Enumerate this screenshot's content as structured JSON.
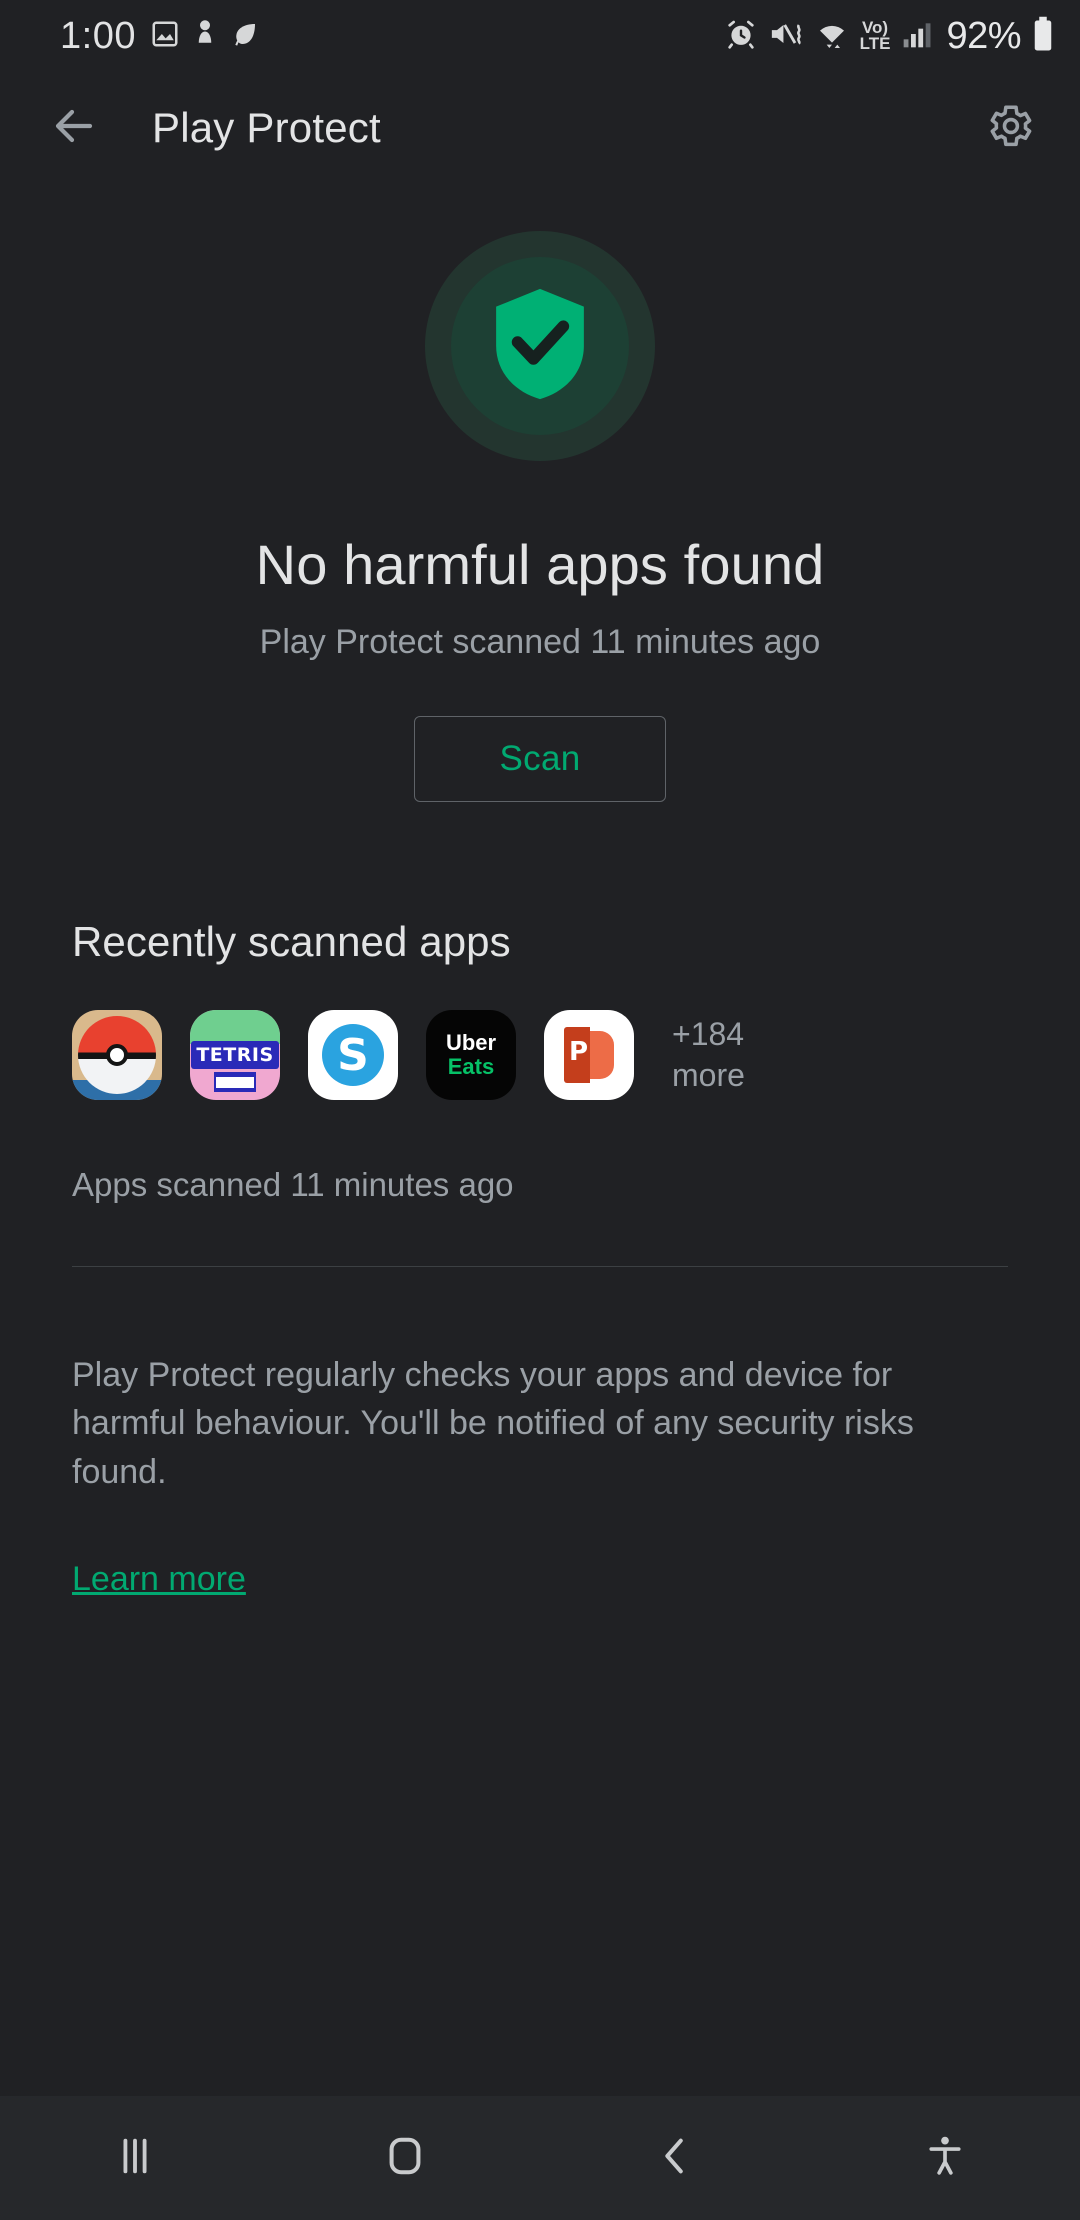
{
  "status_bar": {
    "time": "1:00",
    "battery_percent": "92%",
    "network_label_top": "Vo)",
    "network_label_bottom": "LTE",
    "icons": [
      "image-icon",
      "person-icon",
      "leaf-icon",
      "alarm-icon",
      "mute-vibrate-icon",
      "wifi-icon",
      "volte-icon",
      "signal-icon",
      "battery-icon"
    ]
  },
  "app_bar": {
    "title": "Play Protect",
    "back_icon": "arrow-back-icon",
    "settings_icon": "gear-icon"
  },
  "hero": {
    "shield_icon": "shield-check-icon",
    "title": "No harmful apps found",
    "subtitle": "Play Protect scanned 11 minutes ago",
    "scan_button": "Scan"
  },
  "recent": {
    "section_title": "Recently scanned apps",
    "apps": [
      {
        "name": "Pokemon GO",
        "icon": "pokeball-icon"
      },
      {
        "name": "Tetris",
        "icon": "tetris-icon"
      },
      {
        "name": "Skype",
        "icon": "skype-icon"
      },
      {
        "name": "Uber Eats",
        "icon": "uber-eats-icon"
      },
      {
        "name": "PowerPoint",
        "icon": "powerpoint-icon"
      }
    ],
    "more_count": "+184",
    "more_label": "more",
    "scanned_note": "Apps scanned 11 minutes ago"
  },
  "footer": {
    "blurb": "Play Protect regularly checks your apps and device for harmful behaviour. You'll be notified of any security risks found.",
    "learn_more": "Learn more"
  },
  "nav_bar": {
    "recents": "recents-icon",
    "home": "home-icon",
    "back": "back-icon",
    "accessibility": "accessibility-icon"
  },
  "colors": {
    "background": "#202124",
    "accent_green": "#01a971",
    "shield_green": "#00b074",
    "text_primary": "#e3e4e5",
    "text_secondary": "#9aa0a6",
    "nav_background": "#26282b"
  }
}
